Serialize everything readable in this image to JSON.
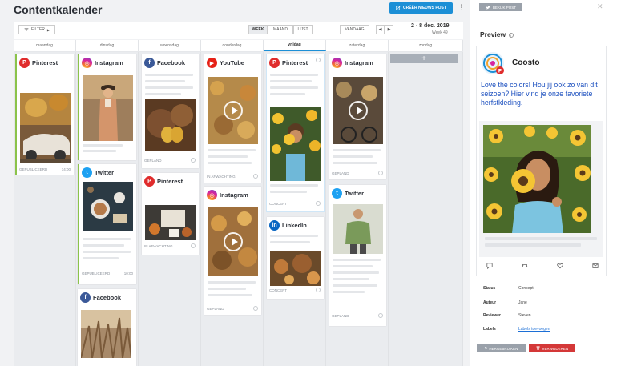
{
  "header": {
    "title": "Contentkalender",
    "create_label": "CRÉËR NIEUWS POST",
    "more_icon": "kebab-icon"
  },
  "toolbar": {
    "filter_label": "FILTER",
    "views": [
      "WEEK",
      "MAAND",
      "LIJST"
    ],
    "active_view": "WEEK",
    "today_label": "VANDAAG",
    "prev_label": "◀",
    "next_label": "▶",
    "date_range": "2 - 8 dec. 2019",
    "week_label": "Week 49"
  },
  "days": [
    "maandag",
    "dinsdag",
    "woensdag",
    "donderdag",
    "vrijdag",
    "zaterdag",
    "zondag"
  ],
  "today_index": 4,
  "add_label": "+",
  "cards": [
    {
      "day": 0,
      "network": "Pinterest",
      "status": "GEPUBLICEERD",
      "time": "14:00"
    },
    {
      "day": 1,
      "network": "Instagram",
      "status": "GEPUBLICEERD",
      "time": "10:00"
    },
    {
      "day": 1,
      "network": "Twitter",
      "status": "GEPUBLICEERD",
      "time": "10:00"
    },
    {
      "day": 1,
      "network": "Facebook",
      "status": "",
      "time": ""
    },
    {
      "day": 2,
      "network": "Facebook",
      "status": "GEPLAND",
      "time": ""
    },
    {
      "day": 2,
      "network": "Pinterest",
      "status": "IN AFWACHTING",
      "time": ""
    },
    {
      "day": 3,
      "network": "YouTube",
      "status": "IN AFWACHTING",
      "time": ""
    },
    {
      "day": 3,
      "network": "Instagram",
      "status": "GEPLAND",
      "time": ""
    },
    {
      "day": 4,
      "network": "Pinterest",
      "status": "CONCEPT",
      "time": ""
    },
    {
      "day": 4,
      "network": "LinkedIn",
      "status": "CONCEPT",
      "time": ""
    },
    {
      "day": 5,
      "network": "Instagram",
      "status": "GEPLAND",
      "time": ""
    },
    {
      "day": 5,
      "network": "Twitter",
      "status": "GEPLAND",
      "time": ""
    }
  ],
  "panel": {
    "view_post_label": "BEKIJK POST",
    "preview_label": "Preview",
    "account_name": "Coosto",
    "post_text": "Love the colors! Hou jij ook zo van dit seizoen? Hier vind je onze favoriete herfstkleding.",
    "meta": [
      {
        "key": "Status",
        "value": "Concept"
      },
      {
        "key": "Auteur",
        "value": "Jane"
      },
      {
        "key": "Reviewer",
        "value": "Steven"
      },
      {
        "key": "Labels",
        "value": "Labels toevoegen"
      }
    ],
    "reuse_label": "HERGEBRUIKEN",
    "delete_label": "VERWIJDEREN"
  },
  "colors": {
    "accent": "#1c8fd6",
    "published": "#8bc34a",
    "delete": "#d43838"
  }
}
